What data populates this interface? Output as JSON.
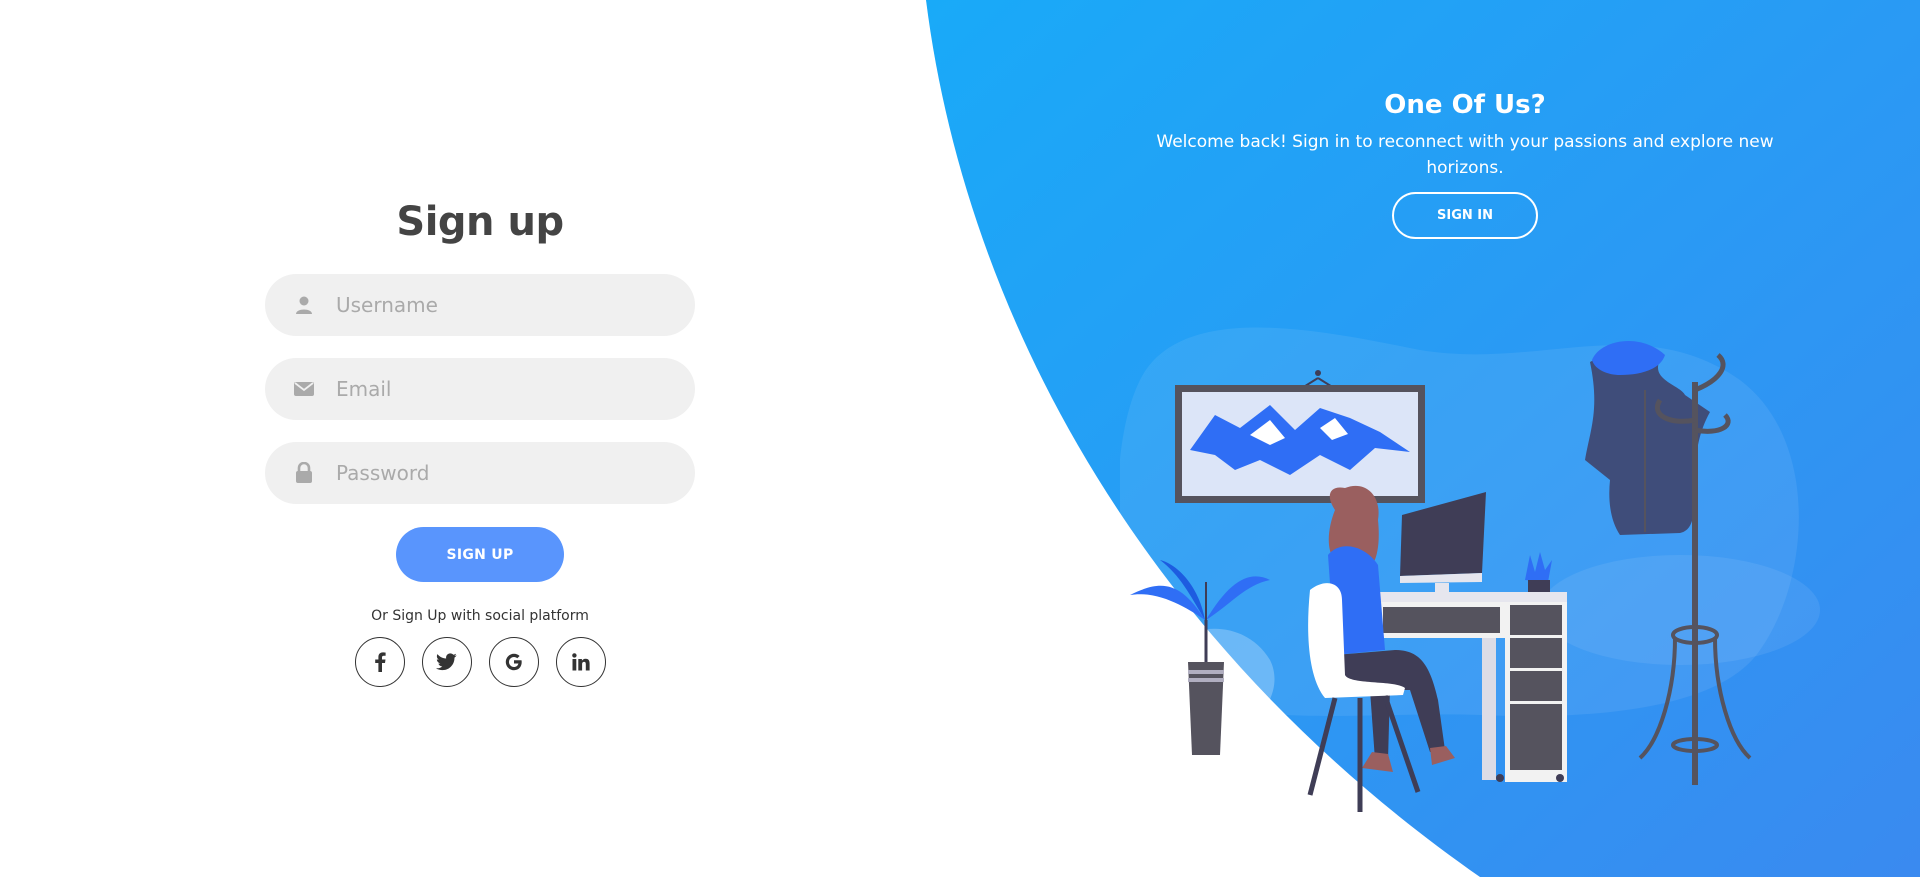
{
  "colors": {
    "accent": "#5995fd",
    "panel_gradient_start": "#1aa7f7",
    "panel_gradient_end": "#3b8ef0",
    "input_bg": "#f0f0f0",
    "title_text": "#444444"
  },
  "signup_form": {
    "title": "Sign up",
    "fields": [
      {
        "icon": "user-icon",
        "placeholder": "Username",
        "value": ""
      },
      {
        "icon": "envelope-icon",
        "placeholder": "Email",
        "value": ""
      },
      {
        "icon": "lock-icon",
        "placeholder": "Password",
        "value": ""
      }
    ],
    "submit_label": "SIGN UP",
    "social_text": "Or Sign Up with social platform",
    "social_icons": [
      "facebook-icon",
      "twitter-icon",
      "google-icon",
      "linkedin-icon"
    ]
  },
  "right_panel": {
    "title": "One Of Us?",
    "text": "Welcome back! Sign in to reconnect with your passions and explore new horizons.",
    "button_label": "SIGN IN"
  }
}
